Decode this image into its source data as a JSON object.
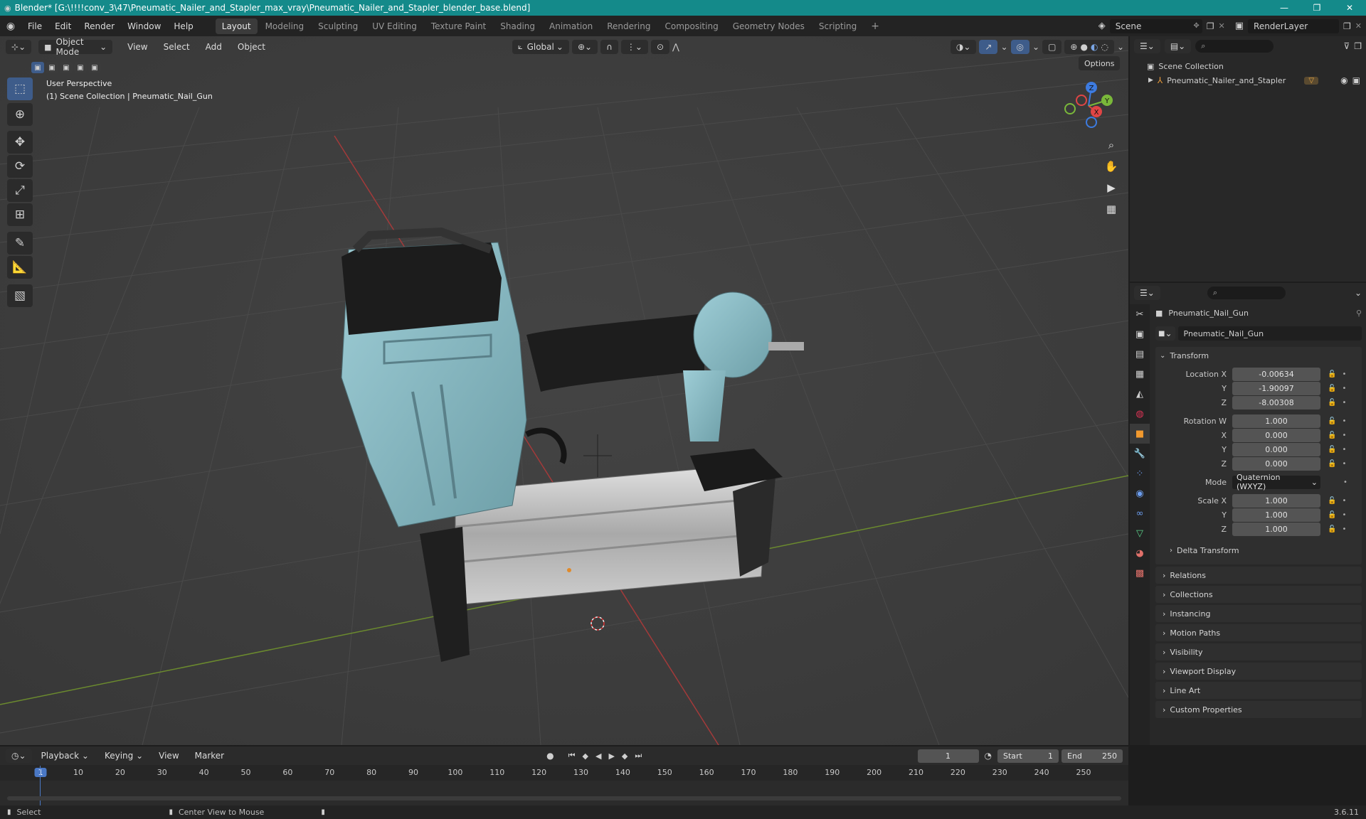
{
  "window": {
    "title": "Blender* [G:\\!!!!conv_3\\47\\Pneumatic_Nailer_and_Stapler_max_vray\\Pneumatic_Nailer_and_Stapler_blender_base.blend]",
    "minimize": "—",
    "maximize": "❐",
    "close": "✕"
  },
  "menu": [
    "File",
    "Edit",
    "Render",
    "Window",
    "Help"
  ],
  "workspaces": [
    {
      "label": "Layout",
      "active": true
    },
    {
      "label": "Modeling"
    },
    {
      "label": "Sculpting"
    },
    {
      "label": "UV Editing"
    },
    {
      "label": "Texture Paint"
    },
    {
      "label": "Shading"
    },
    {
      "label": "Animation"
    },
    {
      "label": "Rendering"
    },
    {
      "label": "Compositing"
    },
    {
      "label": "Geometry Nodes"
    },
    {
      "label": "Scripting"
    }
  ],
  "add_workspace": "+",
  "scene": {
    "name": "Scene",
    "render_layer": "RenderLayer"
  },
  "viewport": {
    "mode": "Object Mode",
    "menus": [
      "View",
      "Select",
      "Add",
      "Object"
    ],
    "transform_orientation": "Global",
    "options": "Options",
    "overlay_line1": "User Perspective",
    "overlay_line2": "(1) Scene Collection | Pneumatic_Nail_Gun",
    "gizmo": {
      "z": "Z",
      "y": "Y",
      "x": "X"
    }
  },
  "outliner": {
    "root": "Scene Collection",
    "items": [
      {
        "label": "Pneumatic_Nailer_and_Stapler"
      }
    ]
  },
  "properties": {
    "object_name": "Pneumatic_Nail_Gun",
    "datablock": "Pneumatic_Nail_Gun",
    "transform": {
      "header": "Transform",
      "location": {
        "label": "Location X",
        "x": "-0.00634",
        "y": "-1.90097",
        "z": "-8.00308"
      },
      "rotation": {
        "label": "Rotation W",
        "w": "1.000",
        "x": "0.000",
        "y": "0.000",
        "z": "0.000"
      },
      "mode": {
        "label": "Mode",
        "value": "Quaternion (WXYZ)"
      },
      "scale": {
        "label": "Scale X",
        "x": "1.000",
        "y": "1.000",
        "z": "1.000"
      },
      "axis": {
        "y": "Y",
        "z": "Z",
        "x": "X"
      },
      "delta": "Delta Transform"
    },
    "panels": [
      "Relations",
      "Collections",
      "Instancing",
      "Motion Paths",
      "Visibility",
      "Viewport Display",
      "Line Art",
      "Custom Properties"
    ]
  },
  "timeline": {
    "menus": [
      "Playback",
      "Keying",
      "View",
      "Marker"
    ],
    "current_frame": "1",
    "start_label": "Start",
    "start": "1",
    "end_label": "End",
    "end": "250",
    "ticks": [
      "1",
      "10",
      "20",
      "30",
      "40",
      "50",
      "60",
      "70",
      "80",
      "90",
      "100",
      "110",
      "120",
      "130",
      "140",
      "150",
      "160",
      "170",
      "180",
      "190",
      "200",
      "210",
      "220",
      "230",
      "240",
      "250"
    ]
  },
  "status": {
    "left": "Select",
    "middle": "Center View to Mouse",
    "version": "3.6.11"
  }
}
